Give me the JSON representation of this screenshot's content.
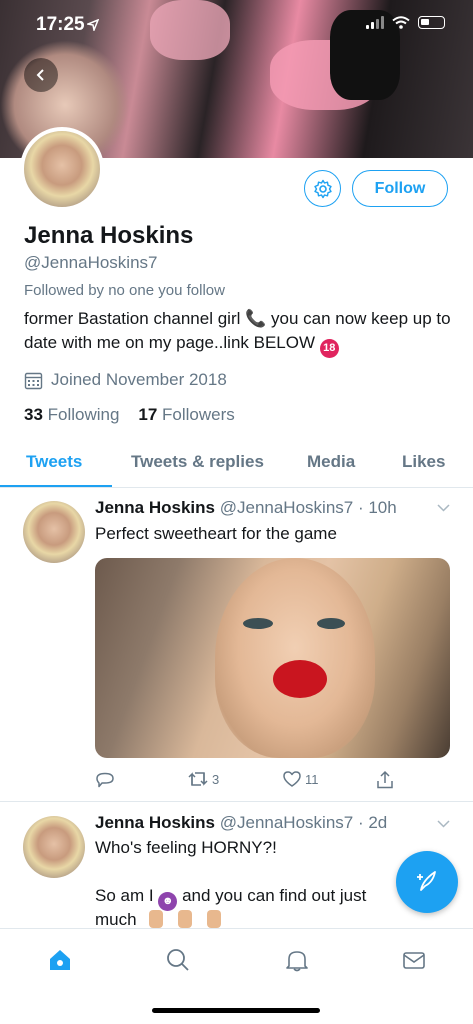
{
  "status_bar": {
    "time": "17:25"
  },
  "profile": {
    "name": "Jenna Hoskins",
    "handle": "@JennaHoskins7",
    "followed_by": "Followed by no one you follow",
    "bio": "former Bastation channel girl 📞 you can now keep up to date with me on my page..link BELOW",
    "joined": "Joined November 2018",
    "following_count": "33",
    "following_label": "Following",
    "followers_count": "17",
    "followers_label": "Followers",
    "follow_label": "Follow"
  },
  "tabs": [
    {
      "label": "Tweets",
      "active": true
    },
    {
      "label": "Tweets & replies",
      "active": false
    },
    {
      "label": "Media",
      "active": false
    },
    {
      "label": "Likes",
      "active": false
    }
  ],
  "tweets": [
    {
      "name": "Jenna Hoskins",
      "meta": "@JennaHoskins7 · 10h",
      "text": "Perfect sweetheart for the game",
      "replies": "",
      "retweets": "3",
      "likes": "11"
    },
    {
      "name": "Jenna Hoskins",
      "meta": "@JennaHoskins7 · 2d",
      "text_line1": "Who's feeling HORNY?!",
      "text_line2_a": "So am I",
      "text_line2_b": "and you can find out just",
      "text_line3": "much"
    }
  ],
  "icons": {
    "back": "back-arrow-icon",
    "settings": "gear-icon",
    "calendar": "calendar-icon",
    "compose": "compose-tweet-icon",
    "home": "home-icon",
    "search": "search-icon",
    "notifications": "bell-icon",
    "messages": "mail-icon"
  },
  "colors": {
    "accent": "#1da1f2",
    "secondary_text": "#657786"
  }
}
